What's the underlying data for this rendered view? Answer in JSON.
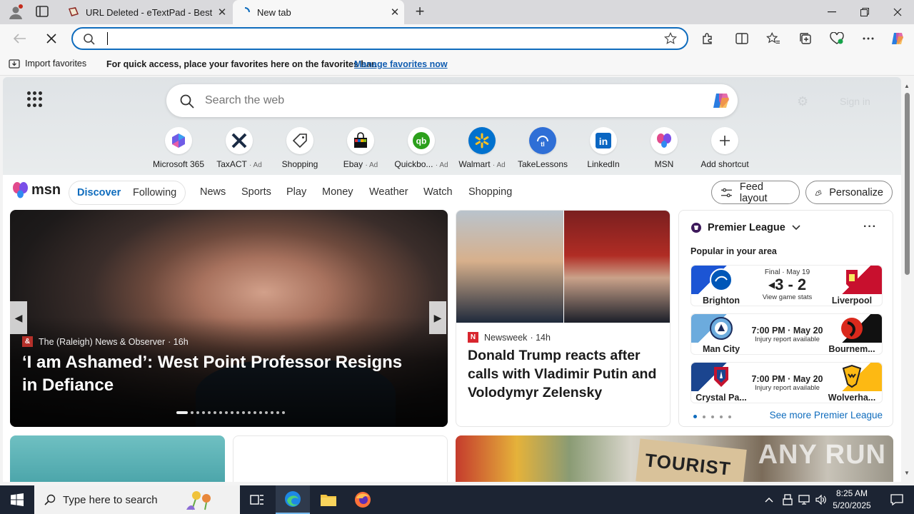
{
  "tabs": [
    {
      "title": "URL Deleted - eTextPad - Best onl",
      "active": false
    },
    {
      "title": "New tab",
      "active": true
    }
  ],
  "address_bar": {
    "value": "",
    "placeholder": ""
  },
  "favorites_bar": {
    "import_label": "Import favorites",
    "hint": "For quick access, place your favorites here on the favorites bar.",
    "manage_link": "Manage favorites now"
  },
  "web_search": {
    "placeholder": "Search the web"
  },
  "faint_header": {
    "signin": "Sign in"
  },
  "shortcuts": [
    {
      "label": "Microsoft 365",
      "ad": ""
    },
    {
      "label": "TaxACT",
      "ad": "· Ad"
    },
    {
      "label": "Shopping",
      "ad": ""
    },
    {
      "label": "Ebay",
      "ad": "· Ad"
    },
    {
      "label": "Quickbo...",
      "ad": "· Ad"
    },
    {
      "label": "Walmart",
      "ad": "· Ad"
    },
    {
      "label": "TakeLessons",
      "ad": ""
    },
    {
      "label": "LinkedIn",
      "ad": ""
    },
    {
      "label": "MSN",
      "ad": ""
    },
    {
      "label": "Add shortcut",
      "ad": ""
    }
  ],
  "msn_nav": {
    "logo": "msn",
    "discover": "Discover",
    "following": "Following",
    "links": [
      "News",
      "Sports",
      "Play",
      "Money",
      "Weather",
      "Watch",
      "Shopping"
    ],
    "feed_layout": "Feed layout",
    "personalize": "Personalize"
  },
  "hero": {
    "source": "The (Raleigh) News & Observer",
    "age": "· 16h",
    "headline": "‘I am Ashamed’: West Point Professor Resigns in Defiance"
  },
  "news_card": {
    "source": "Newsweek",
    "age": "· 14h",
    "headline": "Donald Trump reacts after calls with Vladimir Putin and Volodymyr Zelensky"
  },
  "premier_league": {
    "title": "Premier League",
    "popular": "Popular in your area",
    "matches": [
      {
        "home": "Brighton",
        "away": "Liverpool",
        "status": "Final · May 19",
        "score": "3 - 2",
        "sub": "View game stats"
      },
      {
        "home": "Man City",
        "away": "Bournem...",
        "time": "7:00 PM · May 20",
        "sub": "Injury report available"
      },
      {
        "home": "Crystal Pa...",
        "away": "Wolverha...",
        "time": "7:00 PM · May 20",
        "sub": "Injury report available"
      }
    ],
    "see_more": "See more Premier League"
  },
  "bottom_card": {
    "sign_text": "TOURIST",
    "watermark": "ANY RUN"
  },
  "taskbar": {
    "search_placeholder": "Type here to search",
    "time": "8:25 AM",
    "date": "5/20/2025"
  }
}
